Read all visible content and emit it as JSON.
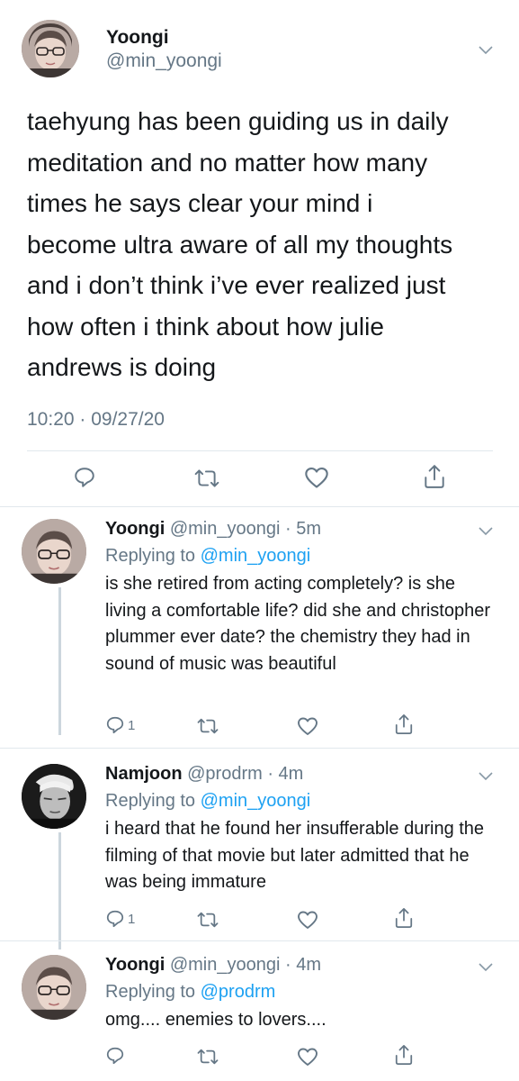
{
  "main_tweet": {
    "display_name": "Yoongi",
    "handle": "@min_yoongi",
    "text": "taehyung has been guiding us in daily\nmeditation and no matter how many\ntimes he says clear your mind i\nbecome ultra aware of all my thoughts\nand i don’t think i’ve ever realized just\nhow often i think about how julie\nandrews is doing",
    "timestamp": "10:20 · 09/27/20"
  },
  "replies": [
    {
      "display_name": "Yoongi",
      "handle_time": "@min_yoongi · 5m",
      "replying_prefix": "Replying to ",
      "replying_to": "@min_yoongi",
      "text": "is she retired from acting completely? is she living a comfortable life? did she and christopher plummer ever date? the chemistry they had in sound of music was beautiful",
      "reply_count": "1"
    },
    {
      "display_name": "Namjoon",
      "handle_time": "@prodrm · 4m",
      "replying_prefix": "Replying to ",
      "replying_to": "@min_yoongi",
      "text": "i heard that he found her insufferable during the filming of that movie but later admitted that he was being immature",
      "reply_count": "1"
    },
    {
      "display_name": "Yoongi",
      "handle_time": "@min_yoongi · 4m",
      "replying_prefix": "Replying to ",
      "replying_to": "@prodrm",
      "text": "omg.... enemies to lovers....",
      "reply_count": ""
    }
  ],
  "colors": {
    "text": "#14171a",
    "secondary": "#657786",
    "link": "#1da1f2",
    "divider": "#e1e8ed",
    "thread_line": "#ccd6dd"
  },
  "icons": [
    "reply-icon",
    "retweet-icon",
    "like-icon",
    "share-icon",
    "chevron-down-icon"
  ]
}
